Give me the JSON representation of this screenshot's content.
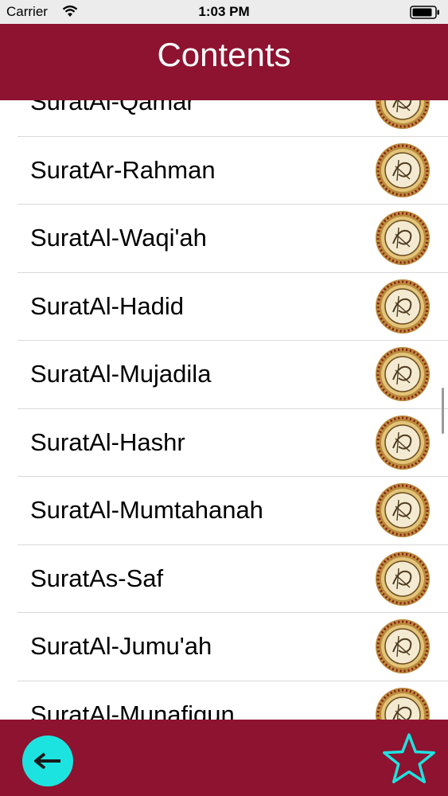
{
  "status_bar": {
    "carrier": "Carrier",
    "time": "1:03 PM"
  },
  "header": {
    "title": "Contents"
  },
  "list": {
    "items": [
      {
        "label": "SuratAl-Qamar"
      },
      {
        "label": "SuratAr-Rahman"
      },
      {
        "label": "SuratAl-Waqi'ah"
      },
      {
        "label": "SuratAl-Hadid"
      },
      {
        "label": "SuratAl-Mujadila"
      },
      {
        "label": "SuratAl-Hashr"
      },
      {
        "label": "SuratAl-Mumtahanah"
      },
      {
        "label": "SuratAs-Saf"
      },
      {
        "label": "SuratAl-Jumu'ah"
      },
      {
        "label": "SuratAl-Munafiqun"
      }
    ]
  },
  "colors": {
    "accent": "#8e1330",
    "back_button": "#1de3e0",
    "favorite_star": "#1de3e0"
  },
  "icons": {
    "row": "quran-medallion-icon",
    "back": "arrow-left-icon",
    "favorite": "star-icon"
  }
}
